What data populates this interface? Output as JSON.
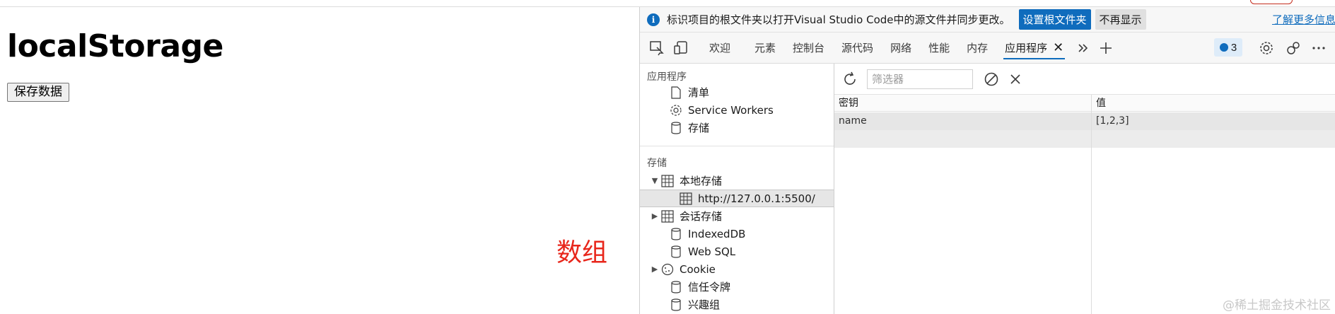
{
  "page": {
    "heading": "localStorage",
    "save_button": "保存数据",
    "annotation": "数组"
  },
  "infobar": {
    "message": "标识项目的根文件夹以打开Visual Studio Code中的源文件并同步更改。",
    "set_root_button": "设置根文件夹",
    "dont_show_button": "不再显示",
    "learn_more": "了解更多信息"
  },
  "tabs": [
    "欢迎",
    "元素",
    "控制台",
    "源代码",
    "网络",
    "性能",
    "内存",
    "应用程序"
  ],
  "active_tab": "应用程序",
  "issues_count": "3",
  "tree": {
    "app_section": "应用程序",
    "app_items": [
      "清单",
      "Service Workers",
      "存储"
    ],
    "storage_section": "存储",
    "storage_items": {
      "local": "本地存储",
      "local_origin": "http://127.0.0.1:5500/",
      "session": "会话存储",
      "indexeddb": "IndexedDB",
      "websql": "Web SQL",
      "cookie": "Cookie",
      "trust": "信任令牌",
      "interest": "兴趣组"
    }
  },
  "panel": {
    "filter_placeholder": "筛选器",
    "columns": [
      "密钥",
      "值"
    ],
    "rows": [
      {
        "key": "name",
        "value": "[1,2,3]"
      }
    ]
  },
  "watermark": "@稀土掘金技术社区",
  "colors": {
    "accent": "#0f6cbd",
    "annotation": "#e8261b"
  }
}
